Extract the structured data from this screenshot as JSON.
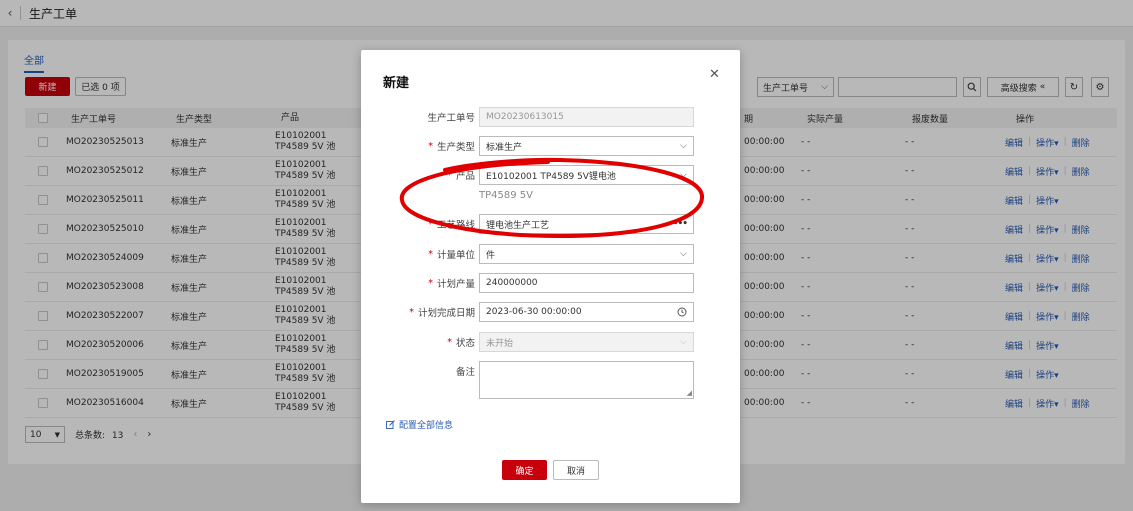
{
  "topbar": {
    "back_icon": "chevron-left-icon",
    "title": "生产工单"
  },
  "tabs": [
    {
      "label": "全部",
      "active": true
    }
  ],
  "toolbar": {
    "new_label": "新建",
    "selected_label": "已选 0 项",
    "search_field": "生产工单号",
    "search_value": "",
    "advanced_label": "高级搜索",
    "advanced_icon": "double-chevron-up-icon"
  },
  "table": {
    "columns": [
      "生产工单号",
      "生产类型",
      "产品",
      "期",
      "实际产量",
      "报废数量",
      "操作"
    ],
    "rows": [
      {
        "no": "MO20230525013",
        "type": "标准生产",
        "product": "E10102001 TP4589 5V 池",
        "date": "00:00:00",
        "actual": "- -",
        "scrap": "- -",
        "ops": [
          "编辑",
          "操作▾",
          "删除"
        ]
      },
      {
        "no": "MO20230525012",
        "type": "标准生产",
        "product": "E10102001 TP4589 5V 池",
        "date": "00:00:00",
        "actual": "- -",
        "scrap": "- -",
        "ops": [
          "编辑",
          "操作▾",
          "删除"
        ]
      },
      {
        "no": "MO20230525011",
        "type": "标准生产",
        "product": "E10102001 TP4589 5V 池",
        "date": "00:00:00",
        "actual": "- -",
        "scrap": "- -",
        "ops": [
          "编辑",
          "操作▾"
        ]
      },
      {
        "no": "MO20230525010",
        "type": "标准生产",
        "product": "E10102001 TP4589 5V 池",
        "date": "00:00:00",
        "actual": "- -",
        "scrap": "- -",
        "ops": [
          "编辑",
          "操作▾",
          "删除"
        ]
      },
      {
        "no": "MO20230524009",
        "type": "标准生产",
        "product": "E10102001 TP4589 5V 池",
        "date": "00:00:00",
        "actual": "- -",
        "scrap": "- -",
        "ops": [
          "编辑",
          "操作▾",
          "删除"
        ]
      },
      {
        "no": "MO20230523008",
        "type": "标准生产",
        "product": "E10102001 TP4589 5V 池",
        "date": "00:00:00",
        "actual": "- -",
        "scrap": "- -",
        "ops": [
          "编辑",
          "操作▾",
          "删除"
        ]
      },
      {
        "no": "MO20230522007",
        "type": "标准生产",
        "product": "E10102001 TP4589 5V 池",
        "date": "00:00:00",
        "actual": "- -",
        "scrap": "- -",
        "ops": [
          "编辑",
          "操作▾",
          "删除"
        ]
      },
      {
        "no": "MO20230520006",
        "type": "标准生产",
        "product": "E10102001 TP4589 5V 池",
        "date": "00:00:00",
        "actual": "- -",
        "scrap": "- -",
        "ops": [
          "编辑",
          "操作▾"
        ]
      },
      {
        "no": "MO20230519005",
        "type": "标准生产",
        "product": "E10102001 TP4589 5V 池",
        "date": "00:00:00",
        "actual": "- -",
        "scrap": "- -",
        "ops": [
          "编辑",
          "操作▾"
        ]
      },
      {
        "no": "MO20230516004",
        "type": "标准生产",
        "product": "E10102001 TP4589 5V 池",
        "date": "00:00:00",
        "actual": "- -",
        "scrap": "- -",
        "ops": [
          "编辑",
          "操作▾",
          "删除"
        ]
      }
    ]
  },
  "pager": {
    "page_size": "10",
    "total_label": "总条数:",
    "total": "13"
  },
  "modal": {
    "title": "新建",
    "fields": {
      "order_no": {
        "label": "生产工单号",
        "value": "MO20230613015",
        "required": false,
        "disabled": true
      },
      "type": {
        "label": "生产类型",
        "value": "标准生产",
        "required": true
      },
      "product": {
        "label": "产品",
        "value": "E10102001 TP4589 5V锂电池",
        "sub": "TP4589 5V",
        "required": true
      },
      "route": {
        "label": "工艺路线",
        "value": "锂电池生产工艺",
        "required": true
      },
      "unit": {
        "label": "计量单位",
        "value": "件",
        "required": true
      },
      "planned_qty": {
        "label": "计划产量",
        "value": "240000000",
        "required": true
      },
      "planned_date": {
        "label": "计划完成日期",
        "value": "2023-06-30 00:00:00",
        "required": true
      },
      "status": {
        "label": "状态",
        "value": "未开始",
        "required": true,
        "disabled": true
      },
      "remark": {
        "label": "备注",
        "value": "",
        "required": false
      }
    },
    "config_link": "配置全部信息",
    "ok_label": "确定",
    "cancel_label": "取消"
  },
  "colors": {
    "brand_red": "#c7000b",
    "link_blue": "#2a5bb5",
    "annotation_red": "#e00000"
  }
}
